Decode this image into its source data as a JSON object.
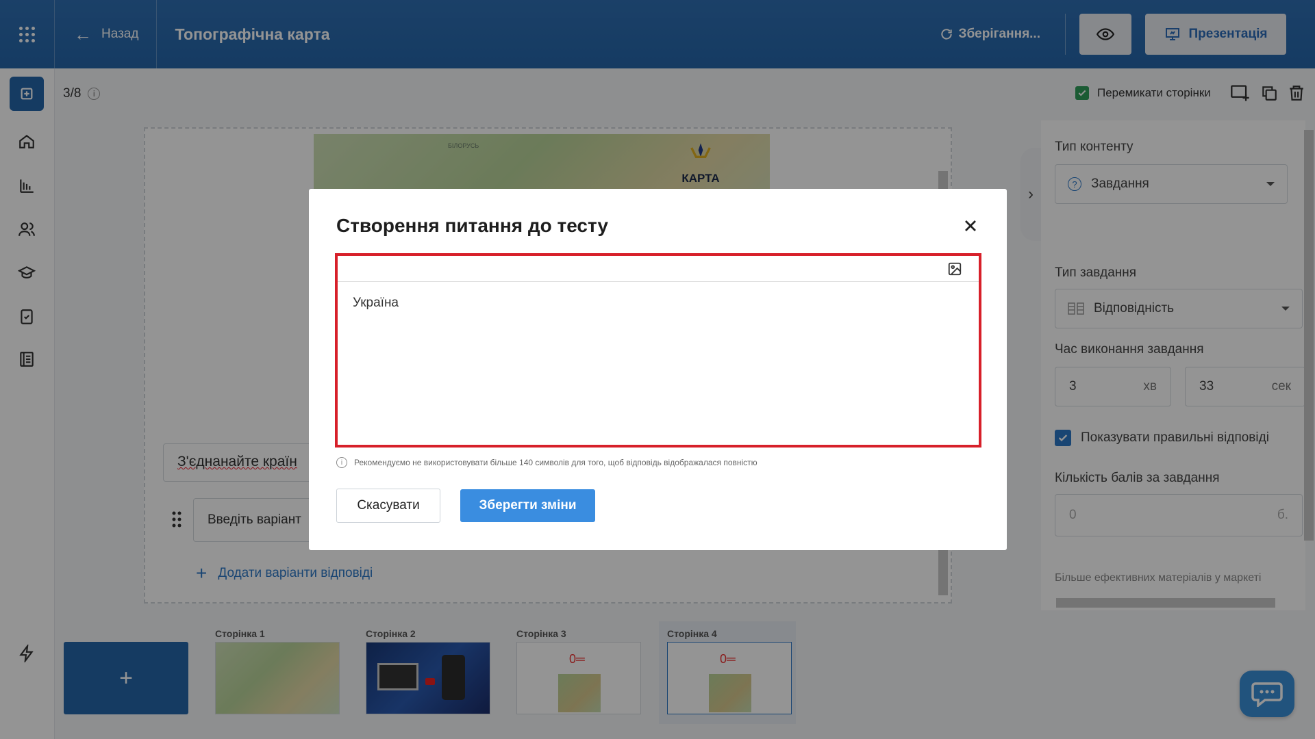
{
  "topbar": {
    "back_label": "Назад",
    "title": "Топографічна карта",
    "saving_label": "Зберігання...",
    "present_label": "Презентація"
  },
  "subbar": {
    "page_counter": "3/8",
    "switch_pages_label": "Перемикати сторінки"
  },
  "canvas": {
    "map_labels": [
      "БІЛОРУСЬ",
      "КАРТА"
    ],
    "question_text": "З'єднанайте країн",
    "option_placeholder": "Введіть варіант",
    "add_options_label": "Додати варіанти відповіді"
  },
  "right_panel": {
    "content_type_label": "Тип контенту",
    "content_type_value": "Завдання",
    "task_type_label": "Тип завдання",
    "task_type_value": "Відповідність",
    "time_label": "Час виконання завдання",
    "minutes_value": "3",
    "minutes_unit": "хв",
    "seconds_value": "33",
    "seconds_unit": "сек",
    "show_answers_label": "Показувати правильні відповіді",
    "score_label": "Кількість балів за завдання",
    "score_placeholder": "0",
    "score_unit": "б.",
    "more_materials": "Більше ефективних матеріалів у маркеті"
  },
  "pages": [
    {
      "label": "Сторінка 1",
      "kind": "map"
    },
    {
      "label": "Сторінка 2",
      "kind": "video"
    },
    {
      "label": "Сторінка 3",
      "kind": "task"
    },
    {
      "label": "Сторінка 4",
      "kind": "task",
      "active": true
    }
  ],
  "modal": {
    "title": "Створення питання до тесту",
    "editor_text": "Україна",
    "hint": "Рекомендуємо не використовувати більше 140 символів для того, щоб відповідь відображалася повністю",
    "cancel_label": "Скасувати",
    "save_label": "Зберегти зміни"
  },
  "colors": {
    "primary": "#2566aa",
    "accent_button": "#3a8de0",
    "highlight_border": "#d7202a",
    "check_green": "#2f9e5b"
  },
  "icons": [
    "apps-grid-icon",
    "arrow-left-icon",
    "refresh-icon",
    "eye-icon",
    "presentation-icon",
    "plus-square-icon",
    "home-icon",
    "chart-icon",
    "users-icon",
    "graduation-cap-icon",
    "checklist-icon",
    "book-icon",
    "lightning-icon",
    "info-icon",
    "add-page-icon",
    "copy-icon",
    "trash-icon",
    "chevron-right-icon",
    "question-circle-icon",
    "table-icon",
    "image-icon",
    "close-icon",
    "chat-icon"
  ]
}
